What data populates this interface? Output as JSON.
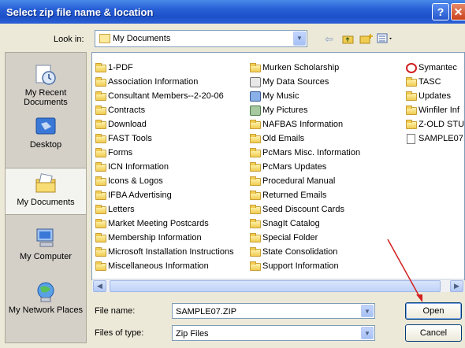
{
  "window": {
    "title": "Select zip file name & location",
    "help_glyph": "?",
    "close_glyph": "✕"
  },
  "lookin": {
    "label": "Look in:",
    "value": "My Documents"
  },
  "places": [
    {
      "id": "recent",
      "label": "My Recent Documents"
    },
    {
      "id": "desktop",
      "label": "Desktop"
    },
    {
      "id": "mydocs",
      "label": "My Documents",
      "selected": true
    },
    {
      "id": "computer",
      "label": "My Computer"
    },
    {
      "id": "network",
      "label": "My Network Places"
    }
  ],
  "files": {
    "col1": [
      "1-PDF",
      "Association Information",
      "Consultant Members--2-20-06",
      "Contracts",
      "Download",
      "FAST Tools",
      "Forms",
      "ICN Information",
      "Icons & Logos",
      "IFBA Advertising",
      "Letters",
      "Market Meeting Postcards",
      "Membership Information",
      "Microsoft Installation Instructions",
      "Miscellaneous Information"
    ],
    "col2": [
      "Murken Scholarship",
      "My Data Sources",
      "My Music",
      "My Pictures",
      "NAFBAS Information",
      "Old Emails",
      "PcMars Misc. Information",
      "PcMars Updates",
      "Procedural Manual",
      "Returned Emails",
      "Seed Discount Cards",
      "SnagIt Catalog",
      "Special Folder",
      "State Consolidation",
      "Support Information"
    ],
    "col3": [
      "Symantec",
      "TASC",
      "Updates",
      "Winfiler Inf",
      "Z-OLD STU",
      "SAMPLE07."
    ]
  },
  "filename": {
    "label": "File name:",
    "value": "SAMPLE07.ZIP"
  },
  "filetype": {
    "label": "Files of type:",
    "value": "Zip Files"
  },
  "buttons": {
    "open": "Open",
    "cancel": "Cancel"
  },
  "colors": {
    "title_bar": "#2a62d8",
    "dialog_bg": "#ece9d8",
    "annotation_arrow": "#d22020"
  }
}
